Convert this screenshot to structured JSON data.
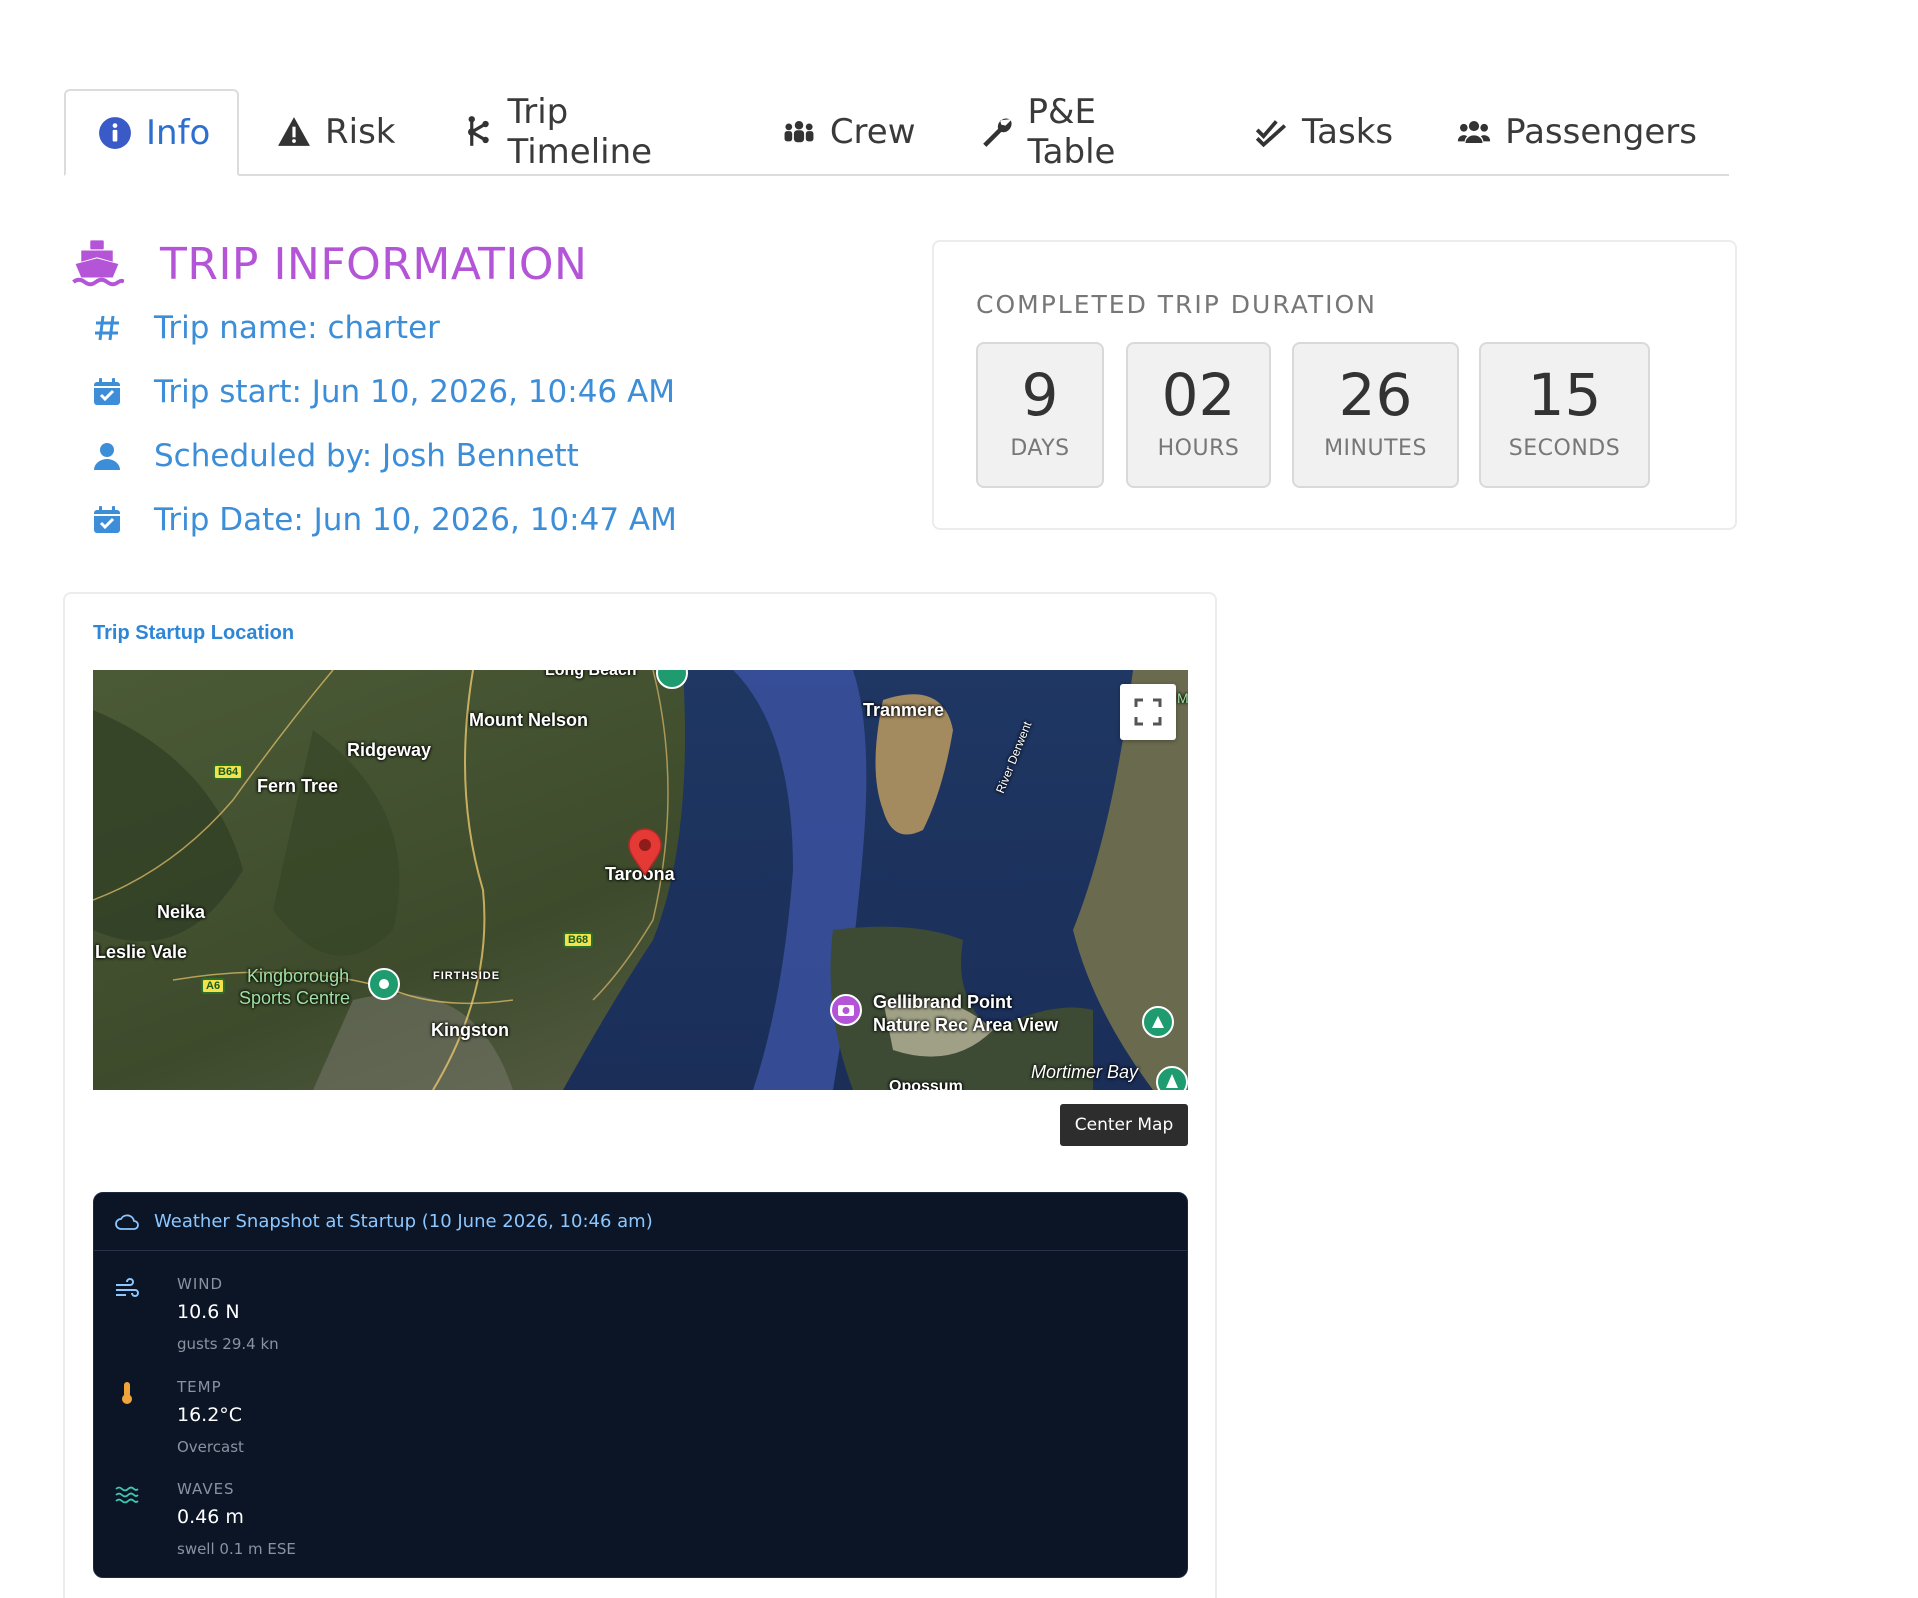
{
  "tabs": [
    {
      "label": "Info",
      "icon": "info-circle-icon",
      "active": true
    },
    {
      "label": "Risk",
      "icon": "warning-triangle-icon"
    },
    {
      "label": "Trip Timeline",
      "icon": "branch-icon"
    },
    {
      "label": "Crew",
      "icon": "people-group-icon"
    },
    {
      "label": "P&E Table",
      "icon": "wrench-icon"
    },
    {
      "label": "Tasks",
      "icon": "double-check-icon"
    },
    {
      "label": "Passengers",
      "icon": "users-icon"
    }
  ],
  "trip": {
    "title": "TRIP INFORMATION",
    "name": "Trip name: charter",
    "start": "Trip start: Jun 10, 2026, 10:46 AM",
    "scheduled_by": "Scheduled by: Josh Bennett",
    "date": "Trip Date: Jun 10, 2026, 10:47 AM"
  },
  "duration": {
    "title": "COMPLETED TRIP DURATION",
    "units": [
      {
        "value": "9",
        "label": "DAYS"
      },
      {
        "value": "02",
        "label": "HOURS"
      },
      {
        "value": "26",
        "label": "MINUTES"
      },
      {
        "value": "15",
        "label": "SECONDS"
      }
    ]
  },
  "location": {
    "title": "Trip Startup Location",
    "center_map_label": "Center Map",
    "map_labels": {
      "long_beach": "Long Beach",
      "mount_nelson": "Mount Nelson",
      "ridgeway": "Ridgeway",
      "fern_tree": "Fern Tree",
      "tranmere": "Tranmere",
      "river_derwent": "River Derwent",
      "taroona": "Taroona",
      "neika": "Neika",
      "leslie_vale": "Leslie Vale",
      "kingborough_1": "Kingborough",
      "kingborough_2": "Sports Centre",
      "firthside": "FIRTHSIDE",
      "kingston": "Kingston",
      "gellibrand_1": "Gellibrand Point",
      "gellibrand_2": "Nature Rec Area View",
      "mortimer_bay": "Mortimer Bay",
      "opossum": "Opossum",
      "m_edge": "M",
      "b64": "B64",
      "b68": "B68",
      "a6": "A6"
    }
  },
  "weather": {
    "title": "Weather Snapshot at Startup (10 June 2026, 10:46 am)",
    "items": [
      {
        "label": "WIND",
        "value": "10.6 N",
        "sub": "gusts 29.4 kn",
        "icon": "wind-icon"
      },
      {
        "label": "TEMP",
        "value": "16.2°C",
        "sub": "Overcast",
        "icon": "thermometer-icon"
      },
      {
        "label": "WAVES",
        "value": "0.46 m",
        "sub": "swell 0.1 m ESE",
        "icon": "waves-icon"
      }
    ]
  },
  "colors": {
    "accent_blue": "#3c8ed8",
    "title_purple": "#b455d8",
    "weather_bg": "#0b1526",
    "pin_red": "#e53935"
  }
}
